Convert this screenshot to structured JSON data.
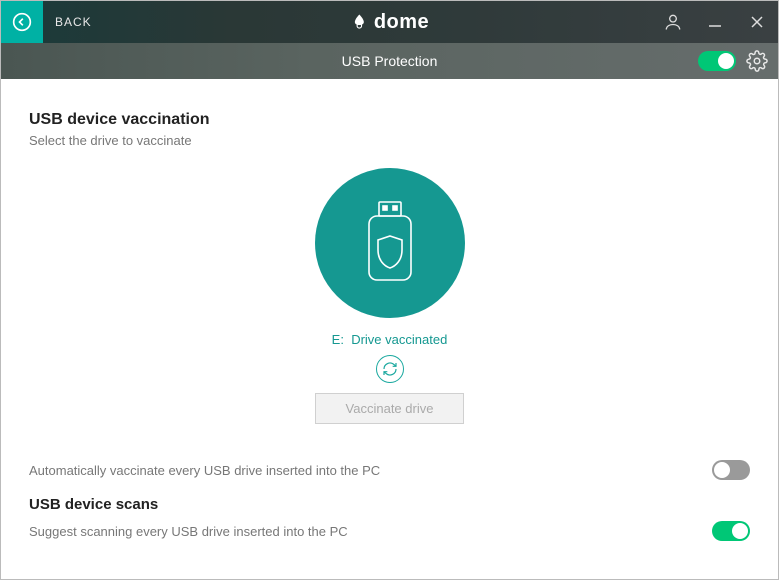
{
  "titlebar": {
    "back_label": "BACK",
    "brand": "dome"
  },
  "subheader": {
    "title": "USB Protection",
    "protection_toggle": true
  },
  "vaccination": {
    "title": "USB device vaccination",
    "subtitle": "Select the drive to vaccinate",
    "drive_letter": "E:",
    "drive_status": "Drive vaccinated",
    "button_label": "Vaccinate drive"
  },
  "auto_vaccinate": {
    "label": "Automatically vaccinate every USB drive inserted into the PC",
    "enabled": false
  },
  "scans": {
    "title": "USB device scans",
    "label": "Suggest scanning every USB drive inserted into the PC",
    "enabled": true
  }
}
